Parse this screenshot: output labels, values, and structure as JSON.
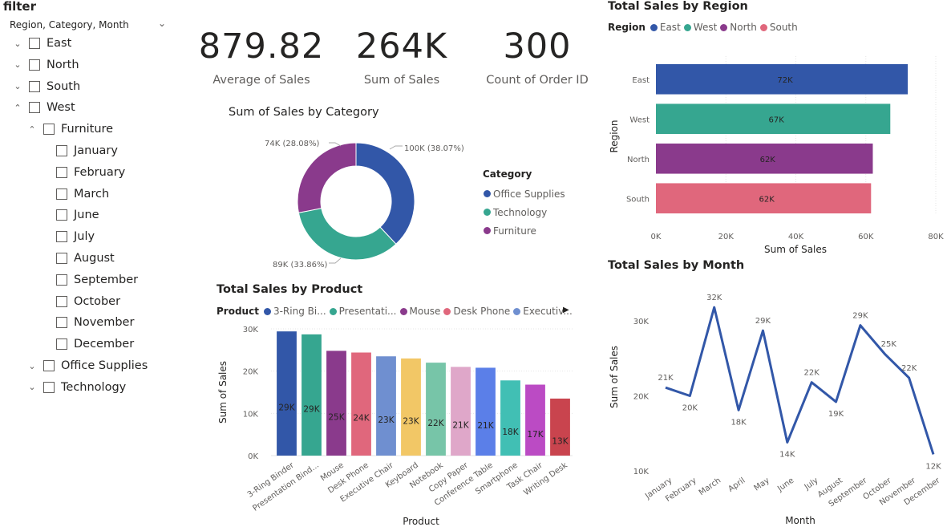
{
  "filter": {
    "title": "filter",
    "field": "Region, Category, Month",
    "tree": [
      {
        "label": "East",
        "level": 0,
        "chevron": "down"
      },
      {
        "label": "North",
        "level": 0,
        "chevron": "down"
      },
      {
        "label": "South",
        "level": 0,
        "chevron": "down"
      },
      {
        "label": "West",
        "level": 0,
        "chevron": "up"
      },
      {
        "label": "Furniture",
        "level": 1,
        "chevron": "up"
      },
      {
        "label": "January",
        "level": 2,
        "chevron": ""
      },
      {
        "label": "February",
        "level": 2,
        "chevron": ""
      },
      {
        "label": "March",
        "level": 2,
        "chevron": ""
      },
      {
        "label": "June",
        "level": 2,
        "chevron": ""
      },
      {
        "label": "July",
        "level": 2,
        "chevron": ""
      },
      {
        "label": "August",
        "level": 2,
        "chevron": ""
      },
      {
        "label": "September",
        "level": 2,
        "chevron": ""
      },
      {
        "label": "October",
        "level": 2,
        "chevron": ""
      },
      {
        "label": "November",
        "level": 2,
        "chevron": ""
      },
      {
        "label": "December",
        "level": 2,
        "chevron": ""
      },
      {
        "label": "Office Supplies",
        "level": 1,
        "chevron": "down"
      },
      {
        "label": "Technology",
        "level": 1,
        "chevron": "down"
      }
    ]
  },
  "kpis": [
    {
      "value": "879.82",
      "label": "Average of Sales"
    },
    {
      "value": "264K",
      "label": "Sum of Sales"
    },
    {
      "value": "300",
      "label": "Count of Order ID"
    }
  ],
  "colors": {
    "office_supplies": "#3257a8",
    "technology": "#36a690",
    "furniture": "#8a3a8c"
  },
  "chart_data": [
    {
      "id": "category",
      "type": "pie",
      "title": "Sum of Sales by Category",
      "legend_title": "Category",
      "legend_position": "right",
      "slices": [
        {
          "name": "Office Supplies",
          "value": 100,
          "label": "100K (38.07%)",
          "color": "#3257a8"
        },
        {
          "name": "Technology",
          "value": 89,
          "label": "89K (33.86%)",
          "color": "#36a690"
        },
        {
          "name": "Furniture",
          "value": 74,
          "label": "74K (28.08%)",
          "color": "#8a3a8c"
        }
      ]
    },
    {
      "id": "product",
      "type": "bar",
      "title": "Total Sales by Product",
      "legend_title": "Product",
      "legend_items": [
        {
          "name": "3-Ring Bi...",
          "color": "#3257a8"
        },
        {
          "name": "Presentati...",
          "color": "#36a690"
        },
        {
          "name": "Mouse",
          "color": "#8a3a8c"
        },
        {
          "name": "Desk Phone",
          "color": "#e0677c"
        },
        {
          "name": "Executiv...",
          "color": "#6f8fd0"
        }
      ],
      "legend_more": "▶",
      "xlabel": "Product",
      "ylabel": "Sum of Sales",
      "ylim": [
        0,
        30000
      ],
      "yticks": [
        {
          "v": 0,
          "t": "0K"
        },
        {
          "v": 10000,
          "t": "10K"
        },
        {
          "v": 20000,
          "t": "20K"
        },
        {
          "v": 30000,
          "t": "30K"
        }
      ],
      "bars": [
        {
          "name": "3-Ring Binder",
          "value": 29400,
          "label": "29K",
          "color": "#3257a8"
        },
        {
          "name": "Presentation Bind...",
          "value": 28700,
          "label": "29K",
          "color": "#36a690"
        },
        {
          "name": "Mouse",
          "value": 24800,
          "label": "25K",
          "color": "#8a3a8c"
        },
        {
          "name": "Desk Phone",
          "value": 24400,
          "label": "24K",
          "color": "#e0677c"
        },
        {
          "name": "Executive Chair",
          "value": 23500,
          "label": "23K",
          "color": "#6f8fd0"
        },
        {
          "name": "Keyboard",
          "value": 23000,
          "label": "23K",
          "color": "#f2c766"
        },
        {
          "name": "Notebook",
          "value": 22000,
          "label": "22K",
          "color": "#77c5a8"
        },
        {
          "name": "Copy Paper",
          "value": 21000,
          "label": "21K",
          "color": "#dfa7c9"
        },
        {
          "name": "Conference Table",
          "value": 20800,
          "label": "21K",
          "color": "#5b7fe8"
        },
        {
          "name": "Smartphone",
          "value": 17800,
          "label": "18K",
          "color": "#41bfb4"
        },
        {
          "name": "Task Chair",
          "value": 16800,
          "label": "17K",
          "color": "#bb4bc4"
        },
        {
          "name": "Writing Desk",
          "value": 13500,
          "label": "13K",
          "color": "#c9444e"
        }
      ]
    },
    {
      "id": "region",
      "type": "bar",
      "orientation": "horizontal",
      "title": "Total Sales by Region",
      "legend_title": "Region",
      "xlabel": "Sum of Sales",
      "ylabel": "Region",
      "xlim": [
        0,
        80000
      ],
      "xticks": [
        {
          "v": 0,
          "t": "0K"
        },
        {
          "v": 20000,
          "t": "20K"
        },
        {
          "v": 40000,
          "t": "40K"
        },
        {
          "v": 60000,
          "t": "60K"
        },
        {
          "v": 80000,
          "t": "80K"
        }
      ],
      "bars": [
        {
          "name": "East",
          "value": 72000,
          "label": "72K",
          "color": "#3257a8"
        },
        {
          "name": "West",
          "value": 67000,
          "label": "67K",
          "color": "#36a690"
        },
        {
          "name": "North",
          "value": 62000,
          "label": "62K",
          "color": "#8a3a8c"
        },
        {
          "name": "South",
          "value": 61500,
          "label": "62K",
          "color": "#e0677c"
        }
      ]
    },
    {
      "id": "month",
      "type": "line",
      "title": "Total Sales by Month",
      "xlabel": "Month",
      "ylabel": "Sum of Sales",
      "ylim": [
        10000,
        32000
      ],
      "yticks": [
        {
          "v": 10000,
          "t": "10K"
        },
        {
          "v": 20000,
          "t": "20K"
        },
        {
          "v": 30000,
          "t": "30K"
        }
      ],
      "color": "#3257a8",
      "points": [
        {
          "x": "January",
          "y": 21100,
          "label": "21K"
        },
        {
          "x": "February",
          "y": 20000,
          "label": "20K"
        },
        {
          "x": "March",
          "y": 31800,
          "label": "32K"
        },
        {
          "x": "April",
          "y": 18100,
          "label": "18K"
        },
        {
          "x": "May",
          "y": 28700,
          "label": "29K"
        },
        {
          "x": "June",
          "y": 13800,
          "label": "14K"
        },
        {
          "x": "July",
          "y": 21800,
          "label": "22K"
        },
        {
          "x": "August",
          "y": 19200,
          "label": "19K"
        },
        {
          "x": "September",
          "y": 29400,
          "label": "29K"
        },
        {
          "x": "October",
          "y": 25600,
          "label": "25K"
        },
        {
          "x": "November",
          "y": 22400,
          "label": "22K"
        },
        {
          "x": "December",
          "y": 12200,
          "label": "12K"
        }
      ]
    }
  ]
}
